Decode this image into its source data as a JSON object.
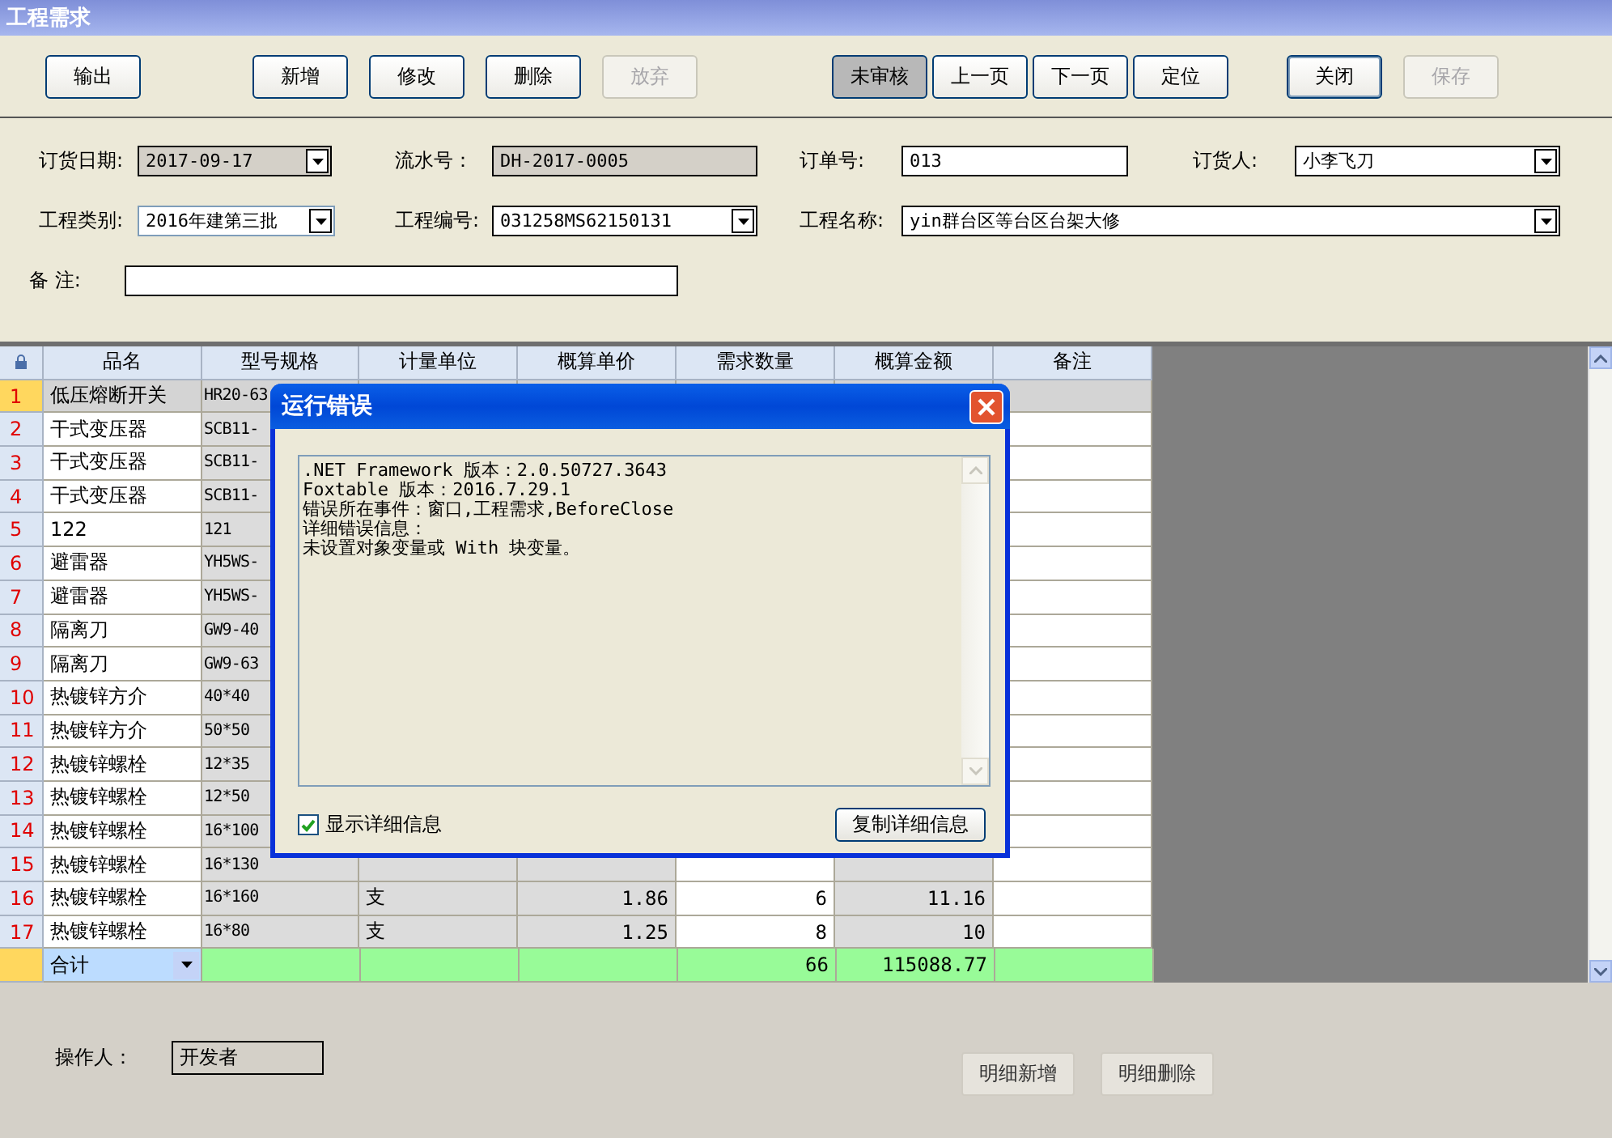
{
  "window": {
    "title": "工程需求"
  },
  "toolbar": {
    "groups": [
      [
        {
          "label": "输出",
          "disabled": false,
          "pressed": false,
          "default": false
        }
      ],
      [
        {
          "label": "新增",
          "disabled": false,
          "pressed": false,
          "default": false
        },
        {
          "label": "修改",
          "disabled": false,
          "pressed": false,
          "default": false
        },
        {
          "label": "删除",
          "disabled": false,
          "pressed": false,
          "default": false
        },
        {
          "label": "放弃",
          "disabled": true,
          "pressed": false,
          "default": false
        }
      ],
      [
        {
          "label": "未审核",
          "disabled": false,
          "pressed": true,
          "default": false
        },
        {
          "label": "上一页",
          "disabled": false,
          "pressed": false,
          "default": false
        },
        {
          "label": "下一页",
          "disabled": false,
          "pressed": false,
          "default": false
        },
        {
          "label": "定位",
          "disabled": false,
          "pressed": false,
          "default": false
        }
      ],
      [
        {
          "label": "关闭",
          "disabled": false,
          "pressed": false,
          "default": true
        },
        {
          "label": "保存",
          "disabled": true,
          "pressed": false,
          "default": false
        }
      ]
    ]
  },
  "form": {
    "rows": [
      [
        {
          "label": "订货日期:",
          "value": "2017-09-17",
          "kind": "combo",
          "readonly": true,
          "focused": false
        },
        {
          "label": "流水号：",
          "value": "DH-2017-0005",
          "kind": "text",
          "readonly": true,
          "focused": false
        },
        {
          "label": "订单号:",
          "value": "013",
          "kind": "text",
          "readonly": false,
          "focused": false
        },
        {
          "label": "订货人:",
          "value": "小李飞刀",
          "kind": "combo",
          "readonly": false,
          "focused": false
        }
      ],
      [
        {
          "label": "工程类别:",
          "value": "2016年建第三批",
          "kind": "combo",
          "readonly": false,
          "focused": true
        },
        {
          "label": "工程编号:",
          "value": "031258MS62150131",
          "kind": "combo",
          "readonly": false,
          "focused": false
        },
        {
          "label": "工程名称:",
          "value": "yin群台区等台区台架大修",
          "kind": "combo",
          "readonly": false,
          "focused": false
        }
      ],
      [
        {
          "label": "备  注:",
          "kind": "text",
          "readonly": false,
          "focused": false
        }
      ]
    ]
  },
  "table": {
    "columns": [
      {
        "label": "品名",
        "shaded": false
      },
      {
        "label": "型号规格",
        "shaded": true
      },
      {
        "label": "计量单位",
        "shaded": true
      },
      {
        "label": "概算单价",
        "shaded": true
      },
      {
        "label": "需求数量",
        "shaded": false
      },
      {
        "label": "概算金额",
        "shaded": true
      },
      {
        "label": "备注",
        "shaded": false
      }
    ],
    "rows": [
      {
        "num": "1",
        "selected": true,
        "cells": [
          "低压熔断开关",
          "HR20-63"
        ]
      },
      {
        "num": "2",
        "selected": false,
        "cells": [
          "干式变压器",
          "SCB11-"
        ]
      },
      {
        "num": "3",
        "selected": false,
        "cells": [
          "干式变压器",
          "SCB11-"
        ]
      },
      {
        "num": "4",
        "selected": false,
        "cells": [
          "干式变压器",
          "SCB11-"
        ]
      },
      {
        "num": "5",
        "selected": false,
        "cells": [
          "122",
          "121"
        ]
      },
      {
        "num": "6",
        "selected": false,
        "cells": [
          "避雷器",
          "YH5WS-"
        ]
      },
      {
        "num": "7",
        "selected": false,
        "cells": [
          "避雷器",
          "YH5WS-"
        ]
      },
      {
        "num": "8",
        "selected": false,
        "cells": [
          "隔离刀",
          "GW9-40"
        ]
      },
      {
        "num": "9",
        "selected": false,
        "cells": [
          "隔离刀",
          "GW9-63"
        ]
      },
      {
        "num": "10",
        "selected": false,
        "cells": [
          "热镀锌方介",
          "40*40"
        ]
      },
      {
        "num": "11",
        "selected": false,
        "cells": [
          "热镀锌方介",
          "50*50"
        ]
      },
      {
        "num": "12",
        "selected": false,
        "cells": [
          "热镀锌螺栓",
          "12*35"
        ]
      },
      {
        "num": "13",
        "selected": false,
        "cells": [
          "热镀锌螺栓",
          "12*50"
        ]
      },
      {
        "num": "14",
        "selected": false,
        "cells": [
          "热镀锌螺栓",
          "16*100"
        ]
      },
      {
        "num": "15",
        "selected": false,
        "cells": [
          "热镀锌螺栓",
          "16*130"
        ]
      },
      {
        "num": "16",
        "selected": false,
        "cells": [
          "热镀锌螺栓",
          "16*160",
          "支",
          "1.86",
          "6",
          "11.16"
        ]
      },
      {
        "num": "17",
        "selected": false,
        "cells": [
          "热镀锌螺栓",
          "16*80",
          "支",
          "1.25",
          "8",
          "10"
        ]
      }
    ],
    "total": {
      "label": "合计",
      "quantity": "66",
      "amount": "115088.77"
    }
  },
  "footer": {
    "operator_label": "操作人：",
    "operator": "开发者",
    "buttons": [
      "明细新增",
      "明细删除"
    ]
  },
  "dialog": {
    "title": "运行错误",
    "lines": [
      ".NET Framework 版本：2.0.50727.3643",
      "Foxtable 版本：2016.7.29.1",
      "错误所在事件：窗口,工程需求,BeforeClose",
      "详细错误信息：",
      "未设置对象变量或 With 块变量。"
    ],
    "show_details": {
      "label": "显示详细信息",
      "checked": true
    },
    "copy_button": "复制详细信息"
  }
}
